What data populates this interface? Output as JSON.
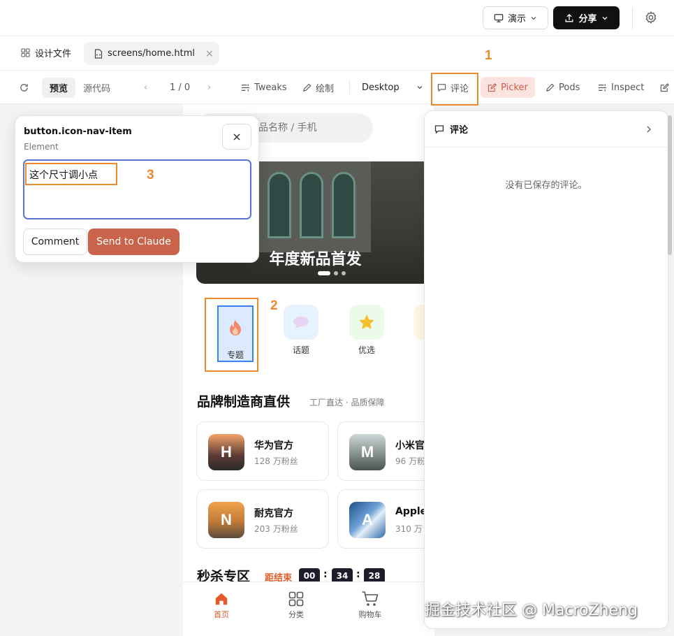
{
  "topbar": {
    "present_label": "演示",
    "share_label": "分享"
  },
  "tabs": {
    "design_files": "设计文件",
    "file_tab": "screens/home.html"
  },
  "toolbar": {
    "preview": "预览",
    "source": "源代码",
    "pager": "1 / 0",
    "tweaks": "Tweaks",
    "draw": "绘制",
    "device": "Desktop",
    "comment": "评论",
    "picker": "Picker",
    "pods": "Pods",
    "inspect": "Inspect"
  },
  "annotations": {
    "a1": "1",
    "a2": "2",
    "a3": "3"
  },
  "popover": {
    "selector": "button.icon-nav-item",
    "type": "Element",
    "comment_text": "这个尺寸调小点",
    "comment_button": "Comment",
    "send_button": "Send to Claude"
  },
  "comments_panel": {
    "title": "评论",
    "empty": "没有已保存的评论。"
  },
  "phone": {
    "search_placeholder": "品名称 / 手机",
    "banner_title": "年度新品首发",
    "nav_items": [
      {
        "label": "专题",
        "icon": "flame-icon"
      },
      {
        "label": "话题",
        "icon": "chat-bubble-icon"
      },
      {
        "label": "优选",
        "icon": "star-icon"
      }
    ],
    "section_title": "品牌制造商直供",
    "section_subtitle": "工厂直达 · 品质保障",
    "brands": [
      {
        "initial": "H",
        "name": "华为官方",
        "fans": "128 万粉丝"
      },
      {
        "initial": "M",
        "name": "小米官",
        "fans": "96 万粉"
      },
      {
        "initial": "N",
        "name": "耐克官方",
        "fans": "203 万粉丝"
      },
      {
        "initial": "A",
        "name": "Apple",
        "fans": "310 万"
      }
    ],
    "flash_title": "秒杀专区",
    "flash_end": "距结束",
    "countdown": [
      "00",
      "34",
      "28"
    ],
    "tabbar": [
      "首页",
      "分类",
      "购物车"
    ]
  },
  "watermark": "掘金技术社区 @ MacroZheng",
  "colors": {
    "accent_orange": "#ee8a2e",
    "send_button": "#c9634a",
    "select_blue": "#3b82f6",
    "active_tab": "#e35a2b"
  }
}
